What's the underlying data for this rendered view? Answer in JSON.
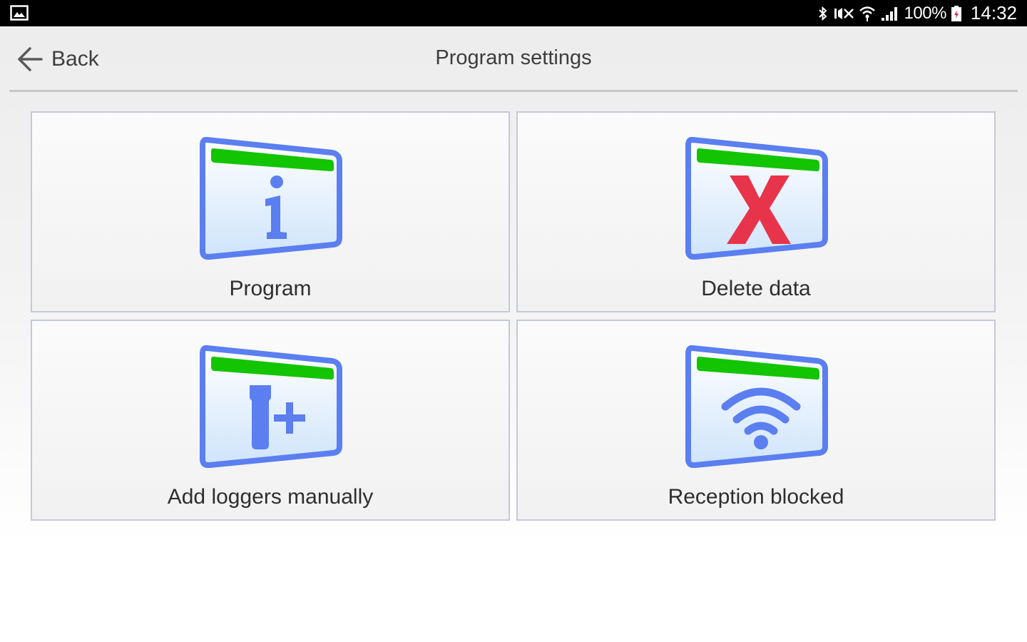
{
  "status_bar": {
    "battery_percent": "100%",
    "time": "14:32",
    "icons": [
      "gallery-icon",
      "bluetooth-icon",
      "mute-icon",
      "wifi-icon",
      "signal-icon",
      "battery-icon"
    ]
  },
  "header": {
    "back_label": "Back",
    "title": "Program settings"
  },
  "tiles": [
    {
      "label": "Program",
      "icon": "info-icon"
    },
    {
      "label": "Delete data",
      "icon": "delete-icon"
    },
    {
      "label": "Add loggers manually",
      "icon": "add-logger-icon"
    },
    {
      "label": "Reception blocked",
      "icon": "reception-icon"
    }
  ],
  "colors": {
    "tile_frame_blue": "#5b7ff0",
    "tile_bar_green": "#13c400",
    "delete_red": "#e8344a",
    "status_bar_bg": "#000000"
  }
}
